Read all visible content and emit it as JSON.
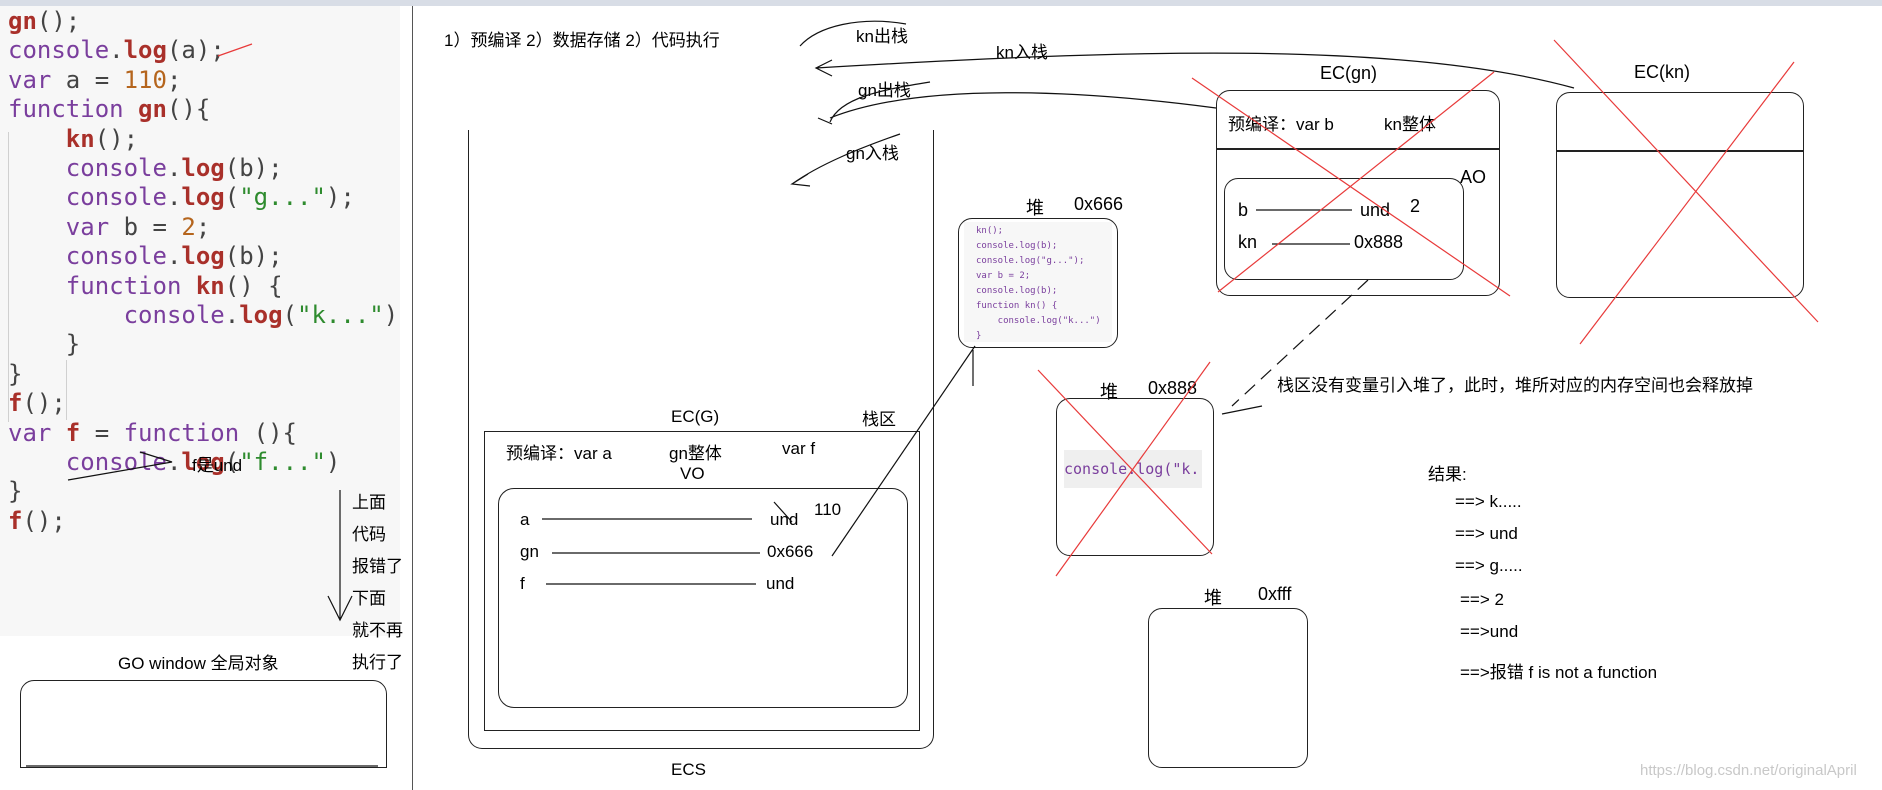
{
  "code_lines": [
    [
      {
        "t": "gn",
        "c": "fn"
      },
      {
        "t": "();",
        "c": "plain"
      }
    ],
    [
      {
        "t": "console",
        "c": "kw"
      },
      {
        "t": ".",
        "c": "plain"
      },
      {
        "t": "log",
        "c": "fn"
      },
      {
        "t": "(a);",
        "c": "plain"
      }
    ],
    [
      {
        "t": "var",
        "c": "kw"
      },
      {
        "t": " a = ",
        "c": "plain"
      },
      {
        "t": "110",
        "c": "num"
      },
      {
        "t": ";",
        "c": "plain"
      }
    ],
    [
      {
        "t": "function ",
        "c": "kw"
      },
      {
        "t": "gn",
        "c": "fn"
      },
      {
        "t": "(){",
        "c": "plain"
      }
    ],
    [
      {
        "t": "    ",
        "c": "plain"
      },
      {
        "t": "kn",
        "c": "fn"
      },
      {
        "t": "();",
        "c": "plain"
      }
    ],
    [
      {
        "t": "    console",
        "c": "kw"
      },
      {
        "t": ".",
        "c": "plain"
      },
      {
        "t": "log",
        "c": "fn"
      },
      {
        "t": "(b);",
        "c": "plain"
      }
    ],
    [
      {
        "t": "    console",
        "c": "kw"
      },
      {
        "t": ".",
        "c": "plain"
      },
      {
        "t": "log",
        "c": "fn"
      },
      {
        "t": "(",
        "c": "plain"
      },
      {
        "t": "\"g...\"",
        "c": "str"
      },
      {
        "t": ");",
        "c": "plain"
      }
    ],
    [
      {
        "t": "    var",
        "c": "kw"
      },
      {
        "t": " b = ",
        "c": "plain"
      },
      {
        "t": "2",
        "c": "num"
      },
      {
        "t": ";",
        "c": "plain"
      }
    ],
    [
      {
        "t": "    console",
        "c": "kw"
      },
      {
        "t": ".",
        "c": "plain"
      },
      {
        "t": "log",
        "c": "fn"
      },
      {
        "t": "(b);",
        "c": "plain"
      }
    ],
    [
      {
        "t": "    function ",
        "c": "kw"
      },
      {
        "t": "kn",
        "c": "fn"
      },
      {
        "t": "() {",
        "c": "plain"
      }
    ],
    [
      {
        "t": "        console",
        "c": "kw"
      },
      {
        "t": ".",
        "c": "plain"
      },
      {
        "t": "log",
        "c": "fn"
      },
      {
        "t": "(",
        "c": "plain"
      },
      {
        "t": "\"k...\"",
        "c": "str"
      },
      {
        "t": ")",
        "c": "plain"
      }
    ],
    [
      {
        "t": "    }",
        "c": "plain"
      }
    ],
    [
      {
        "t": "}",
        "c": "plain"
      }
    ],
    [
      {
        "t": "f",
        "c": "fn"
      },
      {
        "t": "();",
        "c": "plain"
      }
    ],
    [
      {
        "t": "var ",
        "c": "kw"
      },
      {
        "t": "f",
        "c": "fn"
      },
      {
        "t": " = ",
        "c": "plain"
      },
      {
        "t": "function",
        "c": "kw"
      },
      {
        "t": " (){",
        "c": "plain"
      }
    ],
    [
      {
        "t": "    console",
        "c": "kw"
      },
      {
        "t": ".",
        "c": "plain"
      },
      {
        "t": "log",
        "c": "fn"
      },
      {
        "t": "(",
        "c": "plain"
      },
      {
        "t": "\"f...\"",
        "c": "str"
      },
      {
        "t": ")",
        "c": "plain"
      }
    ],
    [
      {
        "t": "}",
        "c": "plain"
      }
    ],
    [
      {
        "t": "f",
        "c": "fn"
      },
      {
        "t": "();",
        "c": "plain"
      }
    ]
  ],
  "annotations": {
    "f_is_und": "f是und",
    "error_note": [
      "上面",
      "代码",
      "报错了",
      "下面",
      "就不再",
      "执行了"
    ],
    "go_label": "GO window 全局对象"
  },
  "phases": "1）预编译  2）数据存储  2）代码执行",
  "stack_ops": {
    "kn_out": "kn出栈",
    "kn_in": "kn入栈",
    "gn_out": "gn出栈",
    "gn_in": "gn入栈"
  },
  "ecs": {
    "label": "ECS",
    "stack_area": "栈区",
    "ecg_title": "EC(G)",
    "precompile": "预编译：var a",
    "gn_whole": "gn整体",
    "var_f": "var f",
    "vo": "VO",
    "vars": [
      {
        "name": "a",
        "value": "und",
        "extra": "110"
      },
      {
        "name": "gn",
        "value": "0x666"
      },
      {
        "name": "f",
        "value": "und"
      }
    ]
  },
  "ec_gn": {
    "title": "EC(gn)",
    "precompile": "预编译：var b",
    "kn_whole": "kn整体",
    "ao": "AO",
    "vars": [
      {
        "name": "b",
        "value": "und",
        "extra": "2"
      },
      {
        "name": "kn",
        "value": "0x888"
      }
    ]
  },
  "ec_kn": {
    "title": "EC(kn)"
  },
  "heap_666": {
    "label": "堆",
    "addr": "0x666",
    "code": [
      "kn();",
      "console.log(b);",
      "console.log(\"g...\");",
      "var b = 2;",
      "console.log(b);",
      "function kn() {",
      "    console.log(\"k...\")",
      "}"
    ]
  },
  "heap_888": {
    "label": "堆",
    "addr": "0x888",
    "code": "console.log(\"k...\")"
  },
  "heap_fff": {
    "label": "堆",
    "addr": "0xfff"
  },
  "release_note": "栈区没有变量引入堆了，此时，堆所对应的内存空间也会释放掉",
  "results": {
    "title": "结果:",
    "lines": [
      "==> k.....",
      "==> und",
      "==> g.....",
      "==> 2",
      "==>und",
      "==>报错  f is not a function"
    ]
  },
  "watermark": "https://blog.csdn.net/originalApril",
  "colors": {
    "cross": "#e83a3a",
    "keyword": "#7a3e9d",
    "function": "#a9302a",
    "string": "#2e8b2e",
    "number": "#b5651d"
  }
}
